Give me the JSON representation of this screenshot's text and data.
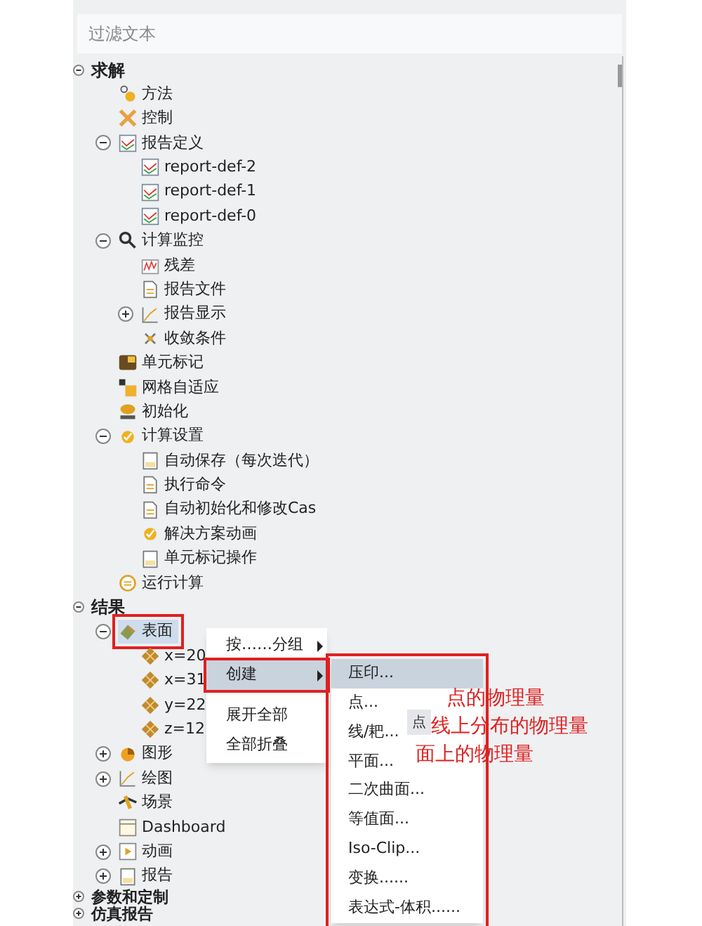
{
  "filter": {
    "placeholder": "过滤文本"
  },
  "tree": [
    {
      "label": "求解",
      "expanded": true,
      "selected": false,
      "children": [
        {
          "label": "方法",
          "kind": "method",
          "selected": false
        },
        {
          "label": "控制",
          "kind": "control",
          "selected": false
        },
        {
          "label": "报告定义",
          "kind": "chart",
          "expanded": true,
          "selected": false,
          "children": [
            {
              "label": "report-def-2",
              "kind": "chart",
              "selected": false
            },
            {
              "label": "report-def-1",
              "kind": "chart",
              "selected": false
            },
            {
              "label": "report-def-0",
              "kind": "chart",
              "selected": false
            }
          ]
        },
        {
          "label": "计算监控",
          "kind": "search",
          "expanded": true,
          "selected": false,
          "children": [
            {
              "label": "残差",
              "kind": "residual",
              "selected": false
            },
            {
              "label": "报告文件",
              "kind": "file",
              "selected": false
            },
            {
              "label": "报告显示",
              "kind": "plot",
              "expanded": false,
              "selected": false
            },
            {
              "label": "收敛条件",
              "kind": "converge",
              "selected": false
            }
          ]
        },
        {
          "label": "单元标记",
          "kind": "cells",
          "selected": false
        },
        {
          "label": "网格自适应",
          "kind": "mesh",
          "selected": false
        },
        {
          "label": "初始化",
          "kind": "init",
          "selected": false
        },
        {
          "label": "计算设置",
          "kind": "check",
          "expanded": true,
          "selected": false,
          "children": [
            {
              "label": "自动保存（每次迭代）",
              "kind": "doc",
              "selected": false
            },
            {
              "label": "执行命令",
              "kind": "file",
              "selected": false
            },
            {
              "label": "自动初始化和修改Cas",
              "kind": "file",
              "selected": false
            },
            {
              "label": "解决方案动画",
              "kind": "check",
              "selected": false
            },
            {
              "label": "单元标记操作",
              "kind": "doc",
              "selected": false
            }
          ]
        },
        {
          "label": "运行计算",
          "kind": "run",
          "selected": false
        }
      ]
    },
    {
      "label": "结果",
      "expanded": true,
      "selected": false,
      "children": [
        {
          "label": "表面",
          "kind": "surface",
          "expanded": true,
          "selected": true,
          "children": [
            {
              "label": "x=20",
              "kind": "grid",
              "selected": false
            },
            {
              "label": "x=31",
              "kind": "grid",
              "selected": false
            },
            {
              "label": "y=22",
              "kind": "grid",
              "selected": false
            },
            {
              "label": "z=12",
              "kind": "grid",
              "selected": false
            }
          ]
        },
        {
          "label": "图形",
          "kind": "graphics",
          "expanded": false,
          "selected": false
        },
        {
          "label": "绘图",
          "kind": "plot",
          "expanded": false,
          "selected": false
        },
        {
          "label": "场景",
          "kind": "scene",
          "selected": false
        },
        {
          "label": "Dashboard",
          "kind": "dashboard",
          "selected": false
        },
        {
          "label": "动画",
          "kind": "anim",
          "expanded": false,
          "selected": false
        },
        {
          "label": "报告",
          "kind": "doc",
          "expanded": false,
          "selected": false
        }
      ]
    },
    {
      "label": "参数和定制",
      "expanded": false,
      "selected": false
    },
    {
      "label": "仿真报告",
      "expanded": false,
      "selected": false
    }
  ],
  "context_menu": {
    "items": [
      {
        "label": "按……分组",
        "submenu": true,
        "selected": false
      },
      {
        "label": "创建",
        "submenu": true,
        "selected": true
      },
      {
        "label": "展开全部",
        "submenu": false,
        "selected": false
      },
      {
        "label": "全部折叠",
        "submenu": false,
        "selected": false
      }
    ]
  },
  "submenu": {
    "items": [
      {
        "label": "压印...",
        "selected": true
      },
      {
        "label": "点...",
        "selected": false
      },
      {
        "label": "线/耙...",
        "selected": false
      },
      {
        "label": "平面...",
        "selected": false
      },
      {
        "label": "二次曲面...",
        "selected": false
      },
      {
        "label": "等值面...",
        "selected": false
      },
      {
        "label": "Iso-Clip...",
        "selected": false
      },
      {
        "label": "变换......",
        "selected": false
      },
      {
        "label": "表达式-体积......",
        "selected": false
      }
    ]
  },
  "tooltip": "点",
  "annotations": [
    "点的物理量",
    "线上分布的物理量",
    "面上的物理量"
  ]
}
